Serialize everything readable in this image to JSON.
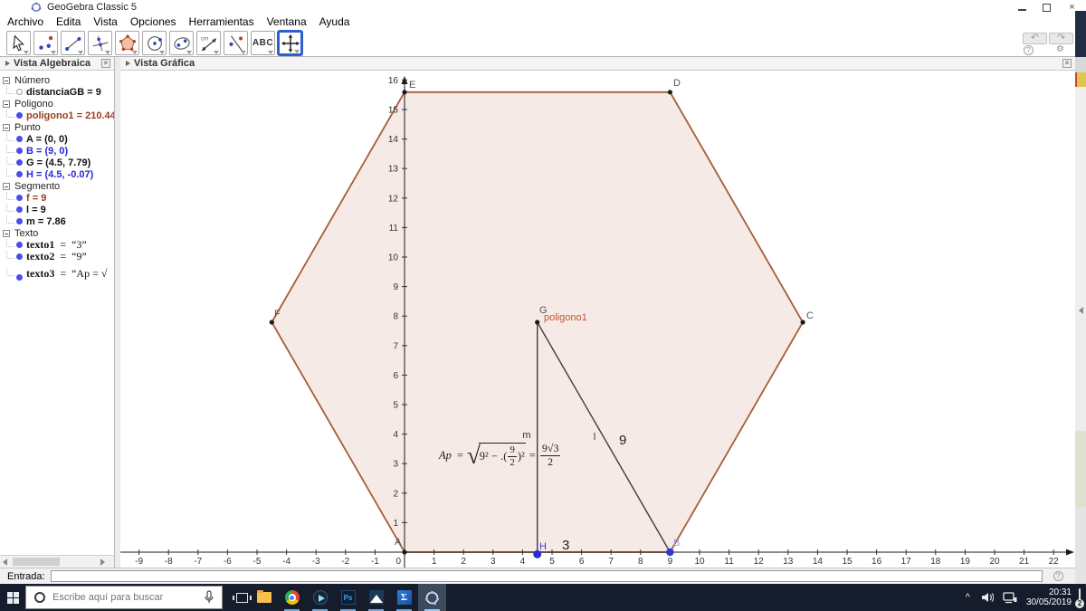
{
  "window": {
    "title": "GeoGebra Classic 5"
  },
  "menu": {
    "items": [
      "Archivo",
      "Edita",
      "Vista",
      "Opciones",
      "Herramientas",
      "Ventana",
      "Ayuda"
    ]
  },
  "toolbar": {
    "abc_label": "ABC",
    "cm_label": "cm",
    "icons": {
      "undo": "↶",
      "redo": "↷",
      "help": "?",
      "settings": "⚙"
    }
  },
  "algebra": {
    "title": "Vista Algebraica",
    "rows": [
      {
        "kind": "cat",
        "label": "Número"
      },
      {
        "kind": "obj",
        "dot": "hollow",
        "label": "distanciaGB = 9",
        "color": "#111111"
      },
      {
        "kind": "cat",
        "label": "Poligono"
      },
      {
        "kind": "obj",
        "dot": "#4b4bf0",
        "label": "poligono1 = 210.44",
        "color": "#9e3b1e"
      },
      {
        "kind": "cat",
        "label": "Punto"
      },
      {
        "kind": "obj",
        "dot": "#4b4bf0",
        "label": "A = (0, 0)",
        "color": "#111111"
      },
      {
        "kind": "obj",
        "dot": "#4b4bf0",
        "label": "B = (9, 0)",
        "color": "#2727d8"
      },
      {
        "kind": "obj",
        "dot": "#4b4bf0",
        "label": "G = (4.5, 7.79)",
        "color": "#111111"
      },
      {
        "kind": "obj",
        "dot": "#4b4bf0",
        "label": "H = (4.5, -0.07)",
        "color": "#2727d8"
      },
      {
        "kind": "cat",
        "label": "Segmento"
      },
      {
        "kind": "obj",
        "dot": "#4b4bf0",
        "label": "f = 9",
        "color": "#9e3b1e"
      },
      {
        "kind": "obj",
        "dot": "#4b4bf0",
        "label": "l = 9",
        "color": "#111111"
      },
      {
        "kind": "obj",
        "dot": "#4b4bf0",
        "label": "m = 7.86",
        "color": "#111111"
      },
      {
        "kind": "cat",
        "label": "Texto"
      },
      {
        "kind": "obj",
        "dot": "#4b4bf0",
        "serif": true,
        "name": "texto1",
        "value": "“3”"
      },
      {
        "kind": "obj",
        "dot": "#4b4bf0",
        "serif": true,
        "name": "texto2",
        "value": "“9”"
      },
      {
        "kind": "obj",
        "dot": "#4b4bf0",
        "serif": true,
        "name": "texto3",
        "value": "“Ap = √",
        "tall": true
      }
    ]
  },
  "graphics": {
    "title": "Vista Gráfica",
    "axis": {
      "x_min": -9,
      "x_max": 22,
      "y_min": 0,
      "y_max": 16
    },
    "point_labels": {
      "A": "A",
      "B": "B",
      "C": "C",
      "D": "D",
      "E": "E",
      "F": "F",
      "G": "G",
      "H": "H"
    },
    "object_labels": {
      "polygon": "poligono1",
      "segment_m": "m",
      "segment_l": "l",
      "text_9": "9",
      "text_3": "3"
    },
    "points": {
      "A": [
        0,
        0
      ],
      "B": [
        9,
        0
      ],
      "C": [
        13.5,
        7.79
      ],
      "D": [
        9,
        15.59
      ],
      "E": [
        0,
        15.59
      ],
      "F": [
        -4.5,
        7.79
      ],
      "G": [
        4.5,
        7.79
      ],
      "H": [
        4.5,
        -0.07
      ]
    },
    "polygon_area": "210.44",
    "formula": {
      "lhs": "Ap",
      "eq": "=",
      "sqrt_sym": "√",
      "pre": "9² − .(",
      "frac1_num": "9",
      "frac1_den": "2",
      "post": ")²",
      "eq2": "=",
      "frac2_num": "9√3",
      "frac2_den": "2"
    },
    "colors": {
      "polygon_stroke": "#a85c38",
      "polygon_fill": "#f5eae6",
      "point_blue": "#3535d8",
      "label_brown": "#c2562e"
    }
  },
  "entrada": {
    "label": "Entrada:",
    "value": "",
    "help_icon": "?"
  },
  "taskbar": {
    "search_placeholder": "Escribe aquí para buscar",
    "time": "20:31",
    "date": "30/05/2019",
    "badge": "2"
  }
}
